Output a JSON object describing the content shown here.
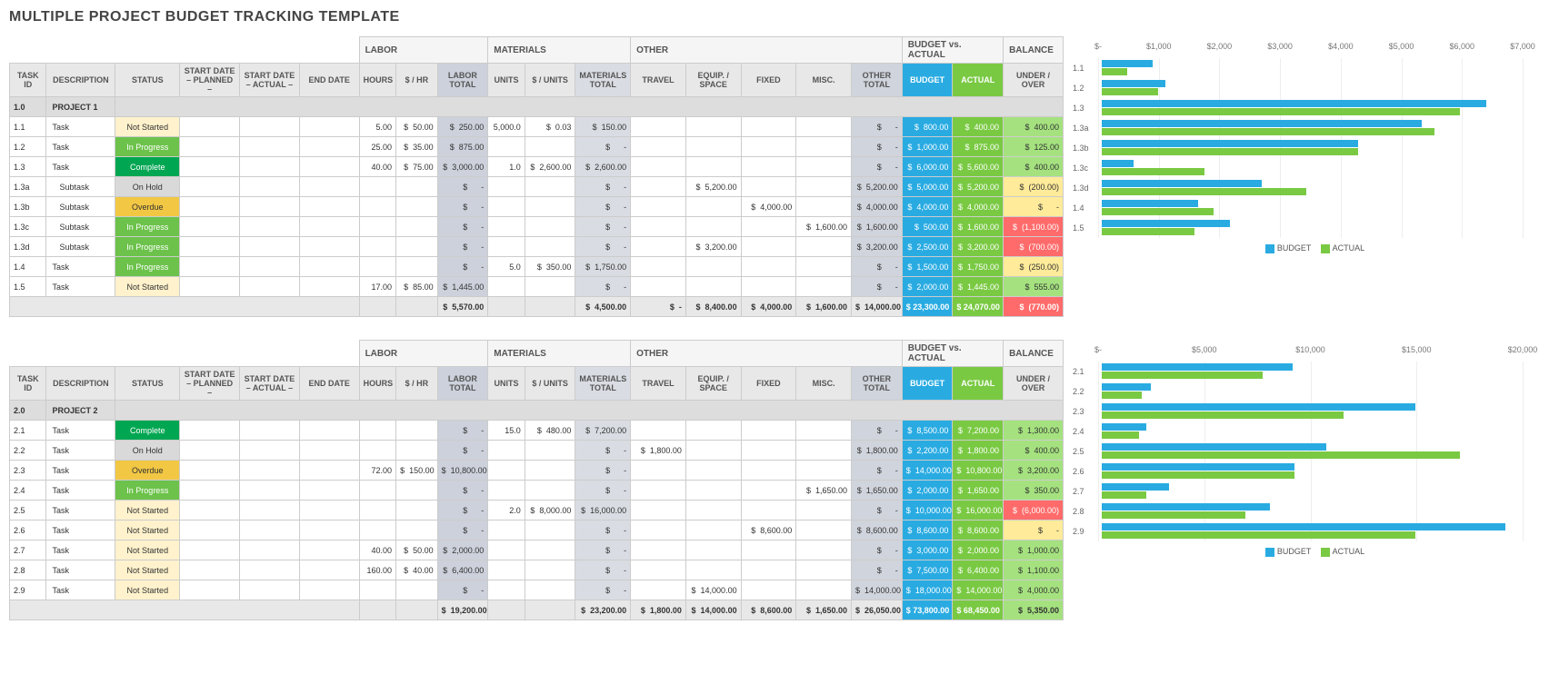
{
  "title": "MULTIPLE PROJECT BUDGET TRACKING TEMPLATE",
  "super_headers": [
    "LABOR",
    "MATERIALS",
    "OTHER",
    "BUDGET vs. ACTUAL",
    "BALANCE"
  ],
  "headers": {
    "task_id": "TASK ID",
    "desc": "DESCRIPTION",
    "status": "STATUS",
    "sd_plan": "START DATE – PLANNED –",
    "sd_act": "START DATE – ACTUAL –",
    "end": "END DATE",
    "hours": "HOURS",
    "rate": "$ / HR",
    "ltot": "LABOR TOTAL",
    "units": "UNITS",
    "uprice": "$ / UNITS",
    "mtot": "MATERIALS TOTAL",
    "travel": "TRAVEL",
    "equip": "EQUIP. / SPACE",
    "fixed": "FIXED",
    "misc": "MISC.",
    "otot": "OTHER TOTAL",
    "budget": "BUDGET",
    "actual": "ACTUAL",
    "bal": "UNDER / OVER"
  },
  "legend": {
    "budget": "BUDGET",
    "actual": "ACTUAL"
  },
  "projects": [
    {
      "proj_id": "1.0",
      "proj_name": "PROJECT 1",
      "rows": [
        {
          "id": "1.1",
          "desc": "Task",
          "indent": 0,
          "status": "Not Started",
          "hours": "5.00",
          "rate": "50.00",
          "ltot": "250.00",
          "units": "5,000.0",
          "uprice": "0.03",
          "mtot": "150.00",
          "travel": "",
          "equip": "",
          "fixed": "",
          "misc": "",
          "otot": "-",
          "budget": "800.00",
          "actual": "400.00",
          "bal": "400.00",
          "balmode": "pos"
        },
        {
          "id": "1.2",
          "desc": "Task",
          "indent": 0,
          "status": "In Progress",
          "hours": "25.00",
          "rate": "35.00",
          "ltot": "875.00",
          "units": "",
          "uprice": "",
          "mtot": "-",
          "travel": "",
          "equip": "",
          "fixed": "",
          "misc": "",
          "otot": "-",
          "budget": "1,000.00",
          "actual": "875.00",
          "bal": "125.00",
          "balmode": "pos"
        },
        {
          "id": "1.3",
          "desc": "Task",
          "indent": 0,
          "status": "Complete",
          "hours": "40.00",
          "rate": "75.00",
          "ltot": "3,000.00",
          "units": "1.0",
          "uprice": "2,600.00",
          "mtot": "2,600.00",
          "travel": "",
          "equip": "",
          "fixed": "",
          "misc": "",
          "otot": "-",
          "budget": "6,000.00",
          "actual": "5,600.00",
          "bal": "400.00",
          "balmode": "pos"
        },
        {
          "id": "1.3a",
          "desc": "Subtask",
          "indent": 1,
          "status": "On Hold",
          "hours": "",
          "rate": "",
          "ltot": "-",
          "units": "",
          "uprice": "",
          "mtot": "-",
          "travel": "",
          "equip": "5,200.00",
          "fixed": "",
          "misc": "",
          "otot": "5,200.00",
          "budget": "5,000.00",
          "actual": "5,200.00",
          "bal": "(200.00)",
          "balmode": "neg2"
        },
        {
          "id": "1.3b",
          "desc": "Subtask",
          "indent": 1,
          "status": "Overdue",
          "hours": "",
          "rate": "",
          "ltot": "-",
          "units": "",
          "uprice": "",
          "mtot": "-",
          "travel": "",
          "equip": "",
          "fixed": "4,000.00",
          "misc": "",
          "otot": "4,000.00",
          "budget": "4,000.00",
          "actual": "4,000.00",
          "bal": "-",
          "balmode": "zero"
        },
        {
          "id": "1.3c",
          "desc": "Subtask",
          "indent": 1,
          "status": "In Progress",
          "hours": "",
          "rate": "",
          "ltot": "-",
          "units": "",
          "uprice": "",
          "mtot": "-",
          "travel": "",
          "equip": "",
          "fixed": "",
          "misc": "1,600.00",
          "otot": "1,600.00",
          "budget": "500.00",
          "actual": "1,600.00",
          "bal": "(1,100.00)",
          "balmode": "neg"
        },
        {
          "id": "1.3d",
          "desc": "Subtask",
          "indent": 1,
          "status": "In Progress",
          "hours": "",
          "rate": "",
          "ltot": "-",
          "units": "",
          "uprice": "",
          "mtot": "-",
          "travel": "",
          "equip": "3,200.00",
          "fixed": "",
          "misc": "",
          "otot": "3,200.00",
          "budget": "2,500.00",
          "actual": "3,200.00",
          "bal": "(700.00)",
          "balmode": "neg"
        },
        {
          "id": "1.4",
          "desc": "Task",
          "indent": 0,
          "status": "In Progress",
          "hours": "",
          "rate": "",
          "ltot": "-",
          "units": "5.0",
          "uprice": "350.00",
          "mtot": "1,750.00",
          "travel": "",
          "equip": "",
          "fixed": "",
          "misc": "",
          "otot": "-",
          "budget": "1,500.00",
          "actual": "1,750.00",
          "bal": "(250.00)",
          "balmode": "neg2"
        },
        {
          "id": "1.5",
          "desc": "Task",
          "indent": 0,
          "status": "Not Started",
          "hours": "17.00",
          "rate": "85.00",
          "ltot": "1,445.00",
          "units": "",
          "uprice": "",
          "mtot": "-",
          "travel": "",
          "equip": "",
          "fixed": "",
          "misc": "",
          "otot": "-",
          "budget": "2,000.00",
          "actual": "1,445.00",
          "bal": "555.00",
          "balmode": "pos"
        }
      ],
      "sum": {
        "ltot": "5,570.00",
        "mtot": "4,500.00",
        "travel": "-",
        "equip": "8,400.00",
        "fixed": "4,000.00",
        "misc": "1,600.00",
        "otot": "14,000.00",
        "budget": "23,300.00",
        "actual": "24,070.00",
        "bal": "(770.00)",
        "balmode": "neg"
      }
    },
    {
      "proj_id": "2.0",
      "proj_name": "PROJECT 2",
      "rows": [
        {
          "id": "2.1",
          "desc": "Task",
          "indent": 0,
          "status": "Complete",
          "hours": "",
          "rate": "",
          "ltot": "-",
          "units": "15.0",
          "uprice": "480.00",
          "mtot": "7,200.00",
          "travel": "",
          "equip": "",
          "fixed": "",
          "misc": "",
          "otot": "-",
          "budget": "8,500.00",
          "actual": "7,200.00",
          "bal": "1,300.00",
          "balmode": "pos"
        },
        {
          "id": "2.2",
          "desc": "Task",
          "indent": 0,
          "status": "On Hold",
          "hours": "",
          "rate": "",
          "ltot": "-",
          "units": "",
          "uprice": "",
          "mtot": "-",
          "travel": "1,800.00",
          "equip": "",
          "fixed": "",
          "misc": "",
          "otot": "1,800.00",
          "budget": "2,200.00",
          "actual": "1,800.00",
          "bal": "400.00",
          "balmode": "pos"
        },
        {
          "id": "2.3",
          "desc": "Task",
          "indent": 0,
          "status": "Overdue",
          "hours": "72.00",
          "rate": "150.00",
          "ltot": "10,800.00",
          "units": "",
          "uprice": "",
          "mtot": "-",
          "travel": "",
          "equip": "",
          "fixed": "",
          "misc": "",
          "otot": "-",
          "budget": "14,000.00",
          "actual": "10,800.00",
          "bal": "3,200.00",
          "balmode": "pos"
        },
        {
          "id": "2.4",
          "desc": "Task",
          "indent": 0,
          "status": "In Progress",
          "hours": "",
          "rate": "",
          "ltot": "-",
          "units": "",
          "uprice": "",
          "mtot": "-",
          "travel": "",
          "equip": "",
          "fixed": "",
          "misc": "1,650.00",
          "otot": "1,650.00",
          "budget": "2,000.00",
          "actual": "1,650.00",
          "bal": "350.00",
          "balmode": "pos"
        },
        {
          "id": "2.5",
          "desc": "Task",
          "indent": 0,
          "status": "Not Started",
          "hours": "",
          "rate": "",
          "ltot": "-",
          "units": "2.0",
          "uprice": "8,000.00",
          "mtot": "16,000.00",
          "travel": "",
          "equip": "",
          "fixed": "",
          "misc": "",
          "otot": "-",
          "budget": "10,000.00",
          "actual": "16,000.00",
          "bal": "(6,000.00)",
          "balmode": "neg"
        },
        {
          "id": "2.6",
          "desc": "Task",
          "indent": 0,
          "status": "Not Started",
          "hours": "",
          "rate": "",
          "ltot": "-",
          "units": "",
          "uprice": "",
          "mtot": "-",
          "travel": "",
          "equip": "",
          "fixed": "8,600.00",
          "misc": "",
          "otot": "8,600.00",
          "budget": "8,600.00",
          "actual": "8,600.00",
          "bal": "-",
          "balmode": "zero"
        },
        {
          "id": "2.7",
          "desc": "Task",
          "indent": 0,
          "status": "Not Started",
          "hours": "40.00",
          "rate": "50.00",
          "ltot": "2,000.00",
          "units": "",
          "uprice": "",
          "mtot": "-",
          "travel": "",
          "equip": "",
          "fixed": "",
          "misc": "",
          "otot": "-",
          "budget": "3,000.00",
          "actual": "2,000.00",
          "bal": "1,000.00",
          "balmode": "pos"
        },
        {
          "id": "2.8",
          "desc": "Task",
          "indent": 0,
          "status": "Not Started",
          "hours": "160.00",
          "rate": "40.00",
          "ltot": "6,400.00",
          "units": "",
          "uprice": "",
          "mtot": "-",
          "travel": "",
          "equip": "",
          "fixed": "",
          "misc": "",
          "otot": "-",
          "budget": "7,500.00",
          "actual": "6,400.00",
          "bal": "1,100.00",
          "balmode": "pos"
        },
        {
          "id": "2.9",
          "desc": "Task",
          "indent": 0,
          "status": "Not Started",
          "hours": "",
          "rate": "",
          "ltot": "-",
          "units": "",
          "uprice": "",
          "mtot": "-",
          "travel": "",
          "equip": "14,000.00",
          "fixed": "",
          "misc": "",
          "otot": "14,000.00",
          "budget": "18,000.00",
          "actual": "14,000.00",
          "bal": "4,000.00",
          "balmode": "pos"
        }
      ],
      "sum": {
        "ltot": "19,200.00",
        "mtot": "23,200.00",
        "travel": "1,800.00",
        "equip": "14,000.00",
        "fixed": "8,600.00",
        "misc": "1,650.00",
        "otot": "26,050.00",
        "budget": "73,800.00",
        "actual": "68,450.00",
        "bal": "5,350.00",
        "balmode": "pos"
      }
    }
  ],
  "chart_data": [
    {
      "type": "bar",
      "categories": [
        "1.1",
        "1.2",
        "1.3",
        "1.3a",
        "1.3b",
        "1.3c",
        "1.3d",
        "1.4",
        "1.5"
      ],
      "series": [
        {
          "name": "BUDGET",
          "values": [
            800,
            1000,
            6000,
            5000,
            4000,
            500,
            2500,
            1500,
            2000
          ]
        },
        {
          "name": "ACTUAL",
          "values": [
            400,
            875,
            5600,
            5200,
            4000,
            1600,
            3200,
            1750,
            1445
          ]
        }
      ],
      "xlabel": "",
      "ylabel": "",
      "xlim": [
        0,
        7000
      ],
      "ticks": [
        "$-",
        "$1,000",
        "$2,000",
        "$3,000",
        "$4,000",
        "$5,000",
        "$6,000",
        "$7,000"
      ]
    },
    {
      "type": "bar",
      "categories": [
        "2.1",
        "2.2",
        "2.3",
        "2.4",
        "2.5",
        "2.6",
        "2.7",
        "2.8",
        "2.9"
      ],
      "series": [
        {
          "name": "BUDGET",
          "values": [
            8500,
            2200,
            14000,
            2000,
            10000,
            8600,
            3000,
            7500,
            18000
          ]
        },
        {
          "name": "ACTUAL",
          "values": [
            7200,
            1800,
            10800,
            1650,
            16000,
            8600,
            2000,
            6400,
            14000
          ]
        }
      ],
      "xlabel": "",
      "ylabel": "",
      "xlim": [
        0,
        20000
      ],
      "ticks": [
        "$-",
        "$5,000",
        "$10,000",
        "$15,000",
        "$20,000"
      ]
    }
  ]
}
